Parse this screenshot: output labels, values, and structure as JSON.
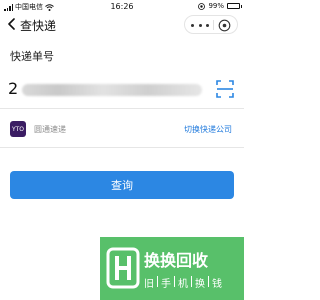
{
  "status_bar": {
    "carrier": "中国电信",
    "time": "16:26",
    "battery": "99%",
    "battery_level": 0.99
  },
  "header": {
    "title": "查快递"
  },
  "form": {
    "number_label": "快递单号",
    "number_prefix": "2",
    "company_name": "圆通速递",
    "company_logo_text": "YTO",
    "switch_label": "切换快递公司"
  },
  "query_button": {
    "label": "查询"
  },
  "watermark": {
    "title": "换换回收",
    "subtitle": [
      "旧",
      "手",
      "机",
      "换",
      "钱"
    ]
  },
  "colors": {
    "accent": "#2c87e3",
    "link": "#1d78dc",
    "watermark_bg": "#58c06a"
  }
}
